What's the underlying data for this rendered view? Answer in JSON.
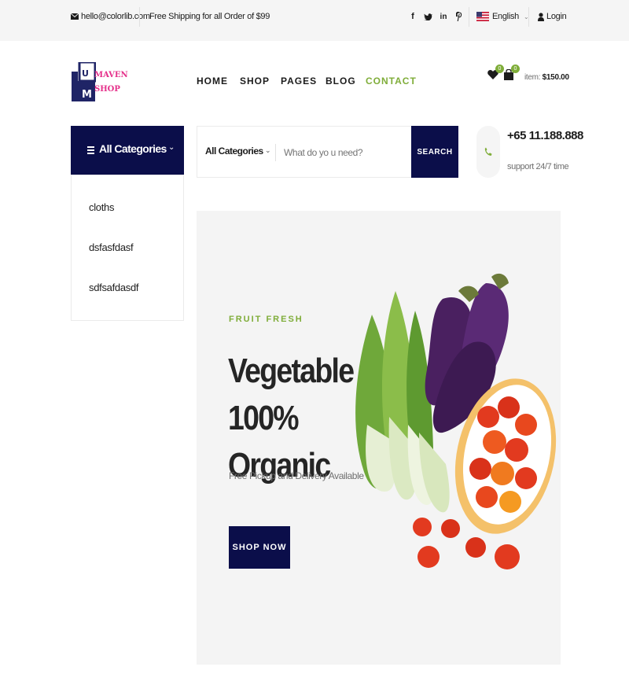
{
  "topbar": {
    "email": "hello@colorlib.com",
    "shipping": "Free Shipping for all Order of $99",
    "language": "English",
    "login": "Login",
    "social_icons": [
      "facebook-icon",
      "twitter-icon",
      "linkedin-icon",
      "pinterest-icon"
    ]
  },
  "logo": {
    "line1": "MAVEN",
    "line2": "SHOP"
  },
  "nav": {
    "items": [
      {
        "label": "HOME"
      },
      {
        "label": "SHOP"
      },
      {
        "label": "PAGES"
      },
      {
        "label": "BLOG"
      },
      {
        "label": "CONTACT",
        "active": true
      }
    ]
  },
  "cart": {
    "wishlist_count": "0",
    "cart_count": "0",
    "item_label": "item:",
    "item_total": "$150.00"
  },
  "categories": {
    "title": "All Categories",
    "items": [
      {
        "label": "cloths"
      },
      {
        "label": "dsfasfdasf"
      },
      {
        "label": "sdfsafdasdf"
      }
    ]
  },
  "search": {
    "category_label": "All Categories",
    "placeholder": "What do yo u need?",
    "button_label": "SEARCH"
  },
  "phone": {
    "number": "+65 11.188.888",
    "support": "support 24/7 time"
  },
  "hero": {
    "tag": "FRUIT FRESH",
    "title_line1": "Vegetable",
    "title_line2": "100% Organic",
    "subtitle": "Free Pickup and Delivery Available",
    "button": "SHOP NOW"
  },
  "colors": {
    "accent": "#7fad39",
    "navy": "#0b0e4a",
    "logo_pink": "#e5308a"
  }
}
